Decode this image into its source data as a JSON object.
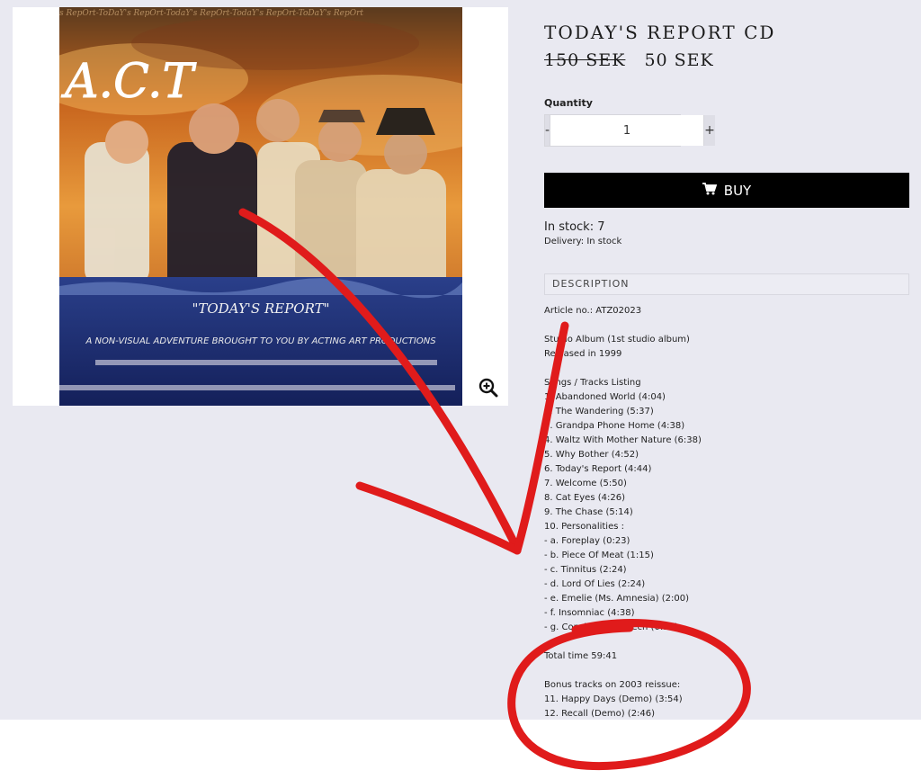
{
  "product": {
    "title": "TODAY'S REPORT CD",
    "price_old": "150 SEK",
    "price_new": "50 SEK"
  },
  "quantity": {
    "label": "Quantity",
    "minus": "-",
    "value": "1",
    "plus": "+"
  },
  "buy": {
    "label": "BUY",
    "icon": "cart-icon"
  },
  "stock": {
    "in_stock": "In stock: 7",
    "delivery": "Delivery: In stock"
  },
  "description": {
    "tab_label": "DESCRIPTION",
    "article_no": "Article no.: ATZ02023",
    "album_type": "Studio Album (1st studio album)",
    "released": "Released in 1999",
    "listing_header": "Songs / Tracks Listing",
    "tracks": [
      "1. Abandoned World (4:04)",
      "2. The Wandering (5:37)",
      "3. Grandpa Phone Home (4:38)",
      "4. Waltz With Mother Nature (6:38)",
      "5. Why Bother (4:52)",
      "6. Today's Report (4:44)",
      "7. Welcome (5:50)",
      "8. Cat Eyes (4:26)",
      "9. The Chase (5:14)",
      "10. Personalities :",
      "- a. Foreplay (0:23)",
      "- b. Piece Of Meat (1:15)",
      "- c. Tinnitus (2:24)",
      "- d. Lord Of Lies (2:24)",
      "- e. Emelie (Ms. Amnesia) (2:00)",
      "- f. Insomniac (4:38)",
      "- g. Concluding Speech (0:34)"
    ],
    "total_time": "Total time 59:41",
    "bonus_header": "Bonus tracks on 2003 reissue:",
    "bonus_tracks": [
      "11. Happy Days (Demo) (3:54)",
      "12. Recall (Demo) (2:46)"
    ]
  },
  "album_art": {
    "logo_text": "A.C.T",
    "caption_title": "\"TODAY'S REPORT\"",
    "caption_line": "A NON-VISUAL ADVENTURE BROUGHT TO YOU BY ACTING ART PRODUCTIONS",
    "top_strip": "s RepOrt-ToDaY's RepOrt-TodaY's RepOrt-TodaY's RepOrt-ToDaY's RepOrt"
  },
  "colors": {
    "page_bg": "#e9e9f1",
    "buy_bg": "#000000",
    "annotation": "#e01b1b"
  }
}
